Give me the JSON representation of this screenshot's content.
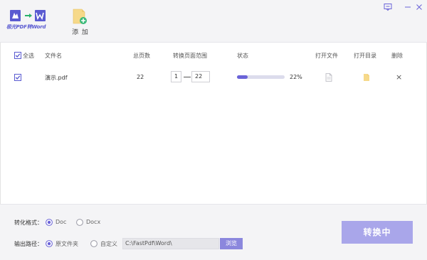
{
  "app": {
    "logo_text": "极光PDF转Word",
    "add_label": "添 加"
  },
  "table": {
    "select_all_label": "全选",
    "headers": {
      "filename": "文件名",
      "total_pages": "总页数",
      "range": "转换页面范围",
      "status": "状态",
      "open_file": "打开文件",
      "open_dir": "打开目录",
      "delete": "删除"
    },
    "rows": [
      {
        "filename": "演示.pdf",
        "total_pages": "22",
        "range_from": "1",
        "range_to": "22",
        "progress": 0.22,
        "progress_text": "22%",
        "delete_symbol": "×"
      }
    ]
  },
  "settings": {
    "format_label": "转化格式：",
    "format_options": [
      "Doc",
      "Docx"
    ],
    "format_selected": "Doc",
    "output_label": "输出路径：",
    "output_options": [
      "原文件夹",
      "自定义"
    ],
    "output_selected": "原文件夹",
    "path_value": "C:\\FastPdf\\Word\\",
    "browse_label": "浏览",
    "convert_label": "转换中"
  },
  "colors": {
    "accent": "#5a5bd1",
    "progress": "#6a63d8",
    "convert_button": "#a9a6ea",
    "browse_button": "#8b87dd",
    "folder_icon": "#f6d98a"
  }
}
